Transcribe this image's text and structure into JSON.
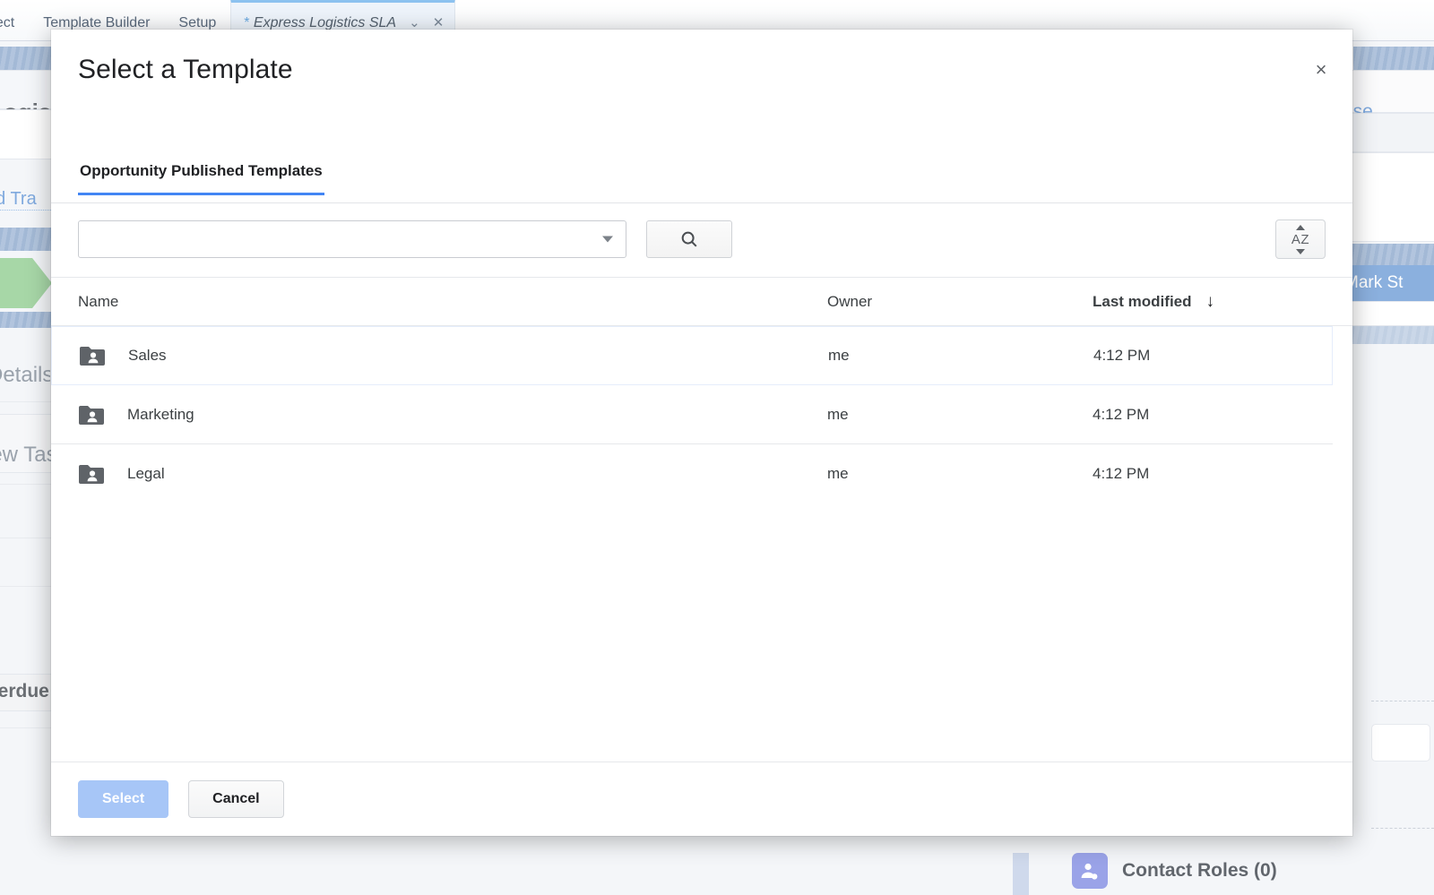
{
  "background": {
    "tabs": [
      {
        "label": "nect",
        "truncated": true
      },
      {
        "label": "Template Builder",
        "truncated": false
      },
      {
        "label": "Setup",
        "truncated": false
      }
    ],
    "active_tab": {
      "asterisk": "*",
      "title": "Express Logistics SLA",
      "dropdown_icon": "chevron-down-icon",
      "close_icon": "close-icon"
    },
    "record_title": "Logist",
    "link_text": "nd Tra",
    "detail_tab": "Details",
    "new_task_label": "lew Tas",
    "overdue_label": "verdue",
    "case_link": "ase",
    "mark_status_button": "Mark St",
    "contact_roles_title": "Contact Roles (0)"
  },
  "modal": {
    "title": "Select a Template",
    "close_label": "×",
    "tabs": [
      {
        "label": "Opportunity Published Templates",
        "active": true
      }
    ],
    "filter": {
      "combo_value": "",
      "combo_placeholder": "",
      "search_button_icon": "search-icon",
      "sort_button_icon": "sort-alpha-icon",
      "sort_button_label": "AZ"
    },
    "table": {
      "columns": [
        {
          "key": "name",
          "label": "Name",
          "sorted": false
        },
        {
          "key": "owner",
          "label": "Owner",
          "sorted": false
        },
        {
          "key": "modified",
          "label": "Last modified",
          "sorted": true,
          "direction": "desc",
          "arrow": "↓"
        }
      ],
      "rows": [
        {
          "icon": "shared-folder-icon",
          "name": "Sales",
          "owner": "me",
          "modified": "4:12 PM",
          "selected": true
        },
        {
          "icon": "shared-folder-icon",
          "name": "Marketing",
          "owner": "me",
          "modified": "4:12 PM",
          "selected": false
        },
        {
          "icon": "shared-folder-icon",
          "name": "Legal",
          "owner": "me",
          "modified": "4:12 PM",
          "selected": false
        }
      ]
    },
    "footer": {
      "select_label": "Select",
      "cancel_label": "Cancel"
    }
  },
  "colors": {
    "accent": "#4285f4",
    "primary_button": "#a7c6f7",
    "active_tab_bg": "#eef4fb",
    "path_green": "#a7d7a7",
    "brand_blue": "#8bb0de"
  }
}
